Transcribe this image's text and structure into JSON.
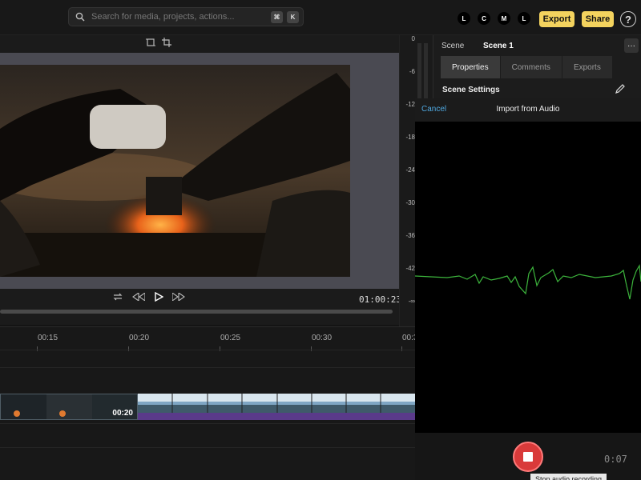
{
  "search": {
    "placeholder": "Search for media, projects, actions...",
    "shortcut_keys": [
      "⌘",
      "K"
    ]
  },
  "layout_modes": [
    "L",
    "C",
    "M",
    "L"
  ],
  "header": {
    "export_label": "Export",
    "share_label": "Share",
    "help_label": "?"
  },
  "player": {
    "timecode": "01:00:23"
  },
  "meter": {
    "labels": [
      "0",
      "-6",
      "-12",
      "-18",
      "-24",
      "-30",
      "-36",
      "-42",
      "-∞"
    ]
  },
  "panel": {
    "scene_label": "Scene",
    "scene_name": "Scene 1",
    "more_label": "···",
    "tabs": [
      {
        "label": "Properties",
        "active": true
      },
      {
        "label": "Comments",
        "active": false
      },
      {
        "label": "Exports",
        "active": false
      }
    ],
    "settings_title": "Scene Settings"
  },
  "timeline": {
    "ruler": [
      "00:15",
      "00:20",
      "00:25",
      "00:30",
      "00:3"
    ],
    "clip_timecode": "00:20"
  },
  "audio_import": {
    "cancel_label": "Cancel",
    "title": "Import from Audio",
    "elapsed": "0:07",
    "tooltip": "Stop audio recording"
  },
  "colors": {
    "accent_yellow": "#f4d35e",
    "waveform_green": "#3cb43c",
    "record_red": "#d93a3a",
    "link_blue": "#4fa8e0",
    "track_purple": "#5a3a8a"
  }
}
